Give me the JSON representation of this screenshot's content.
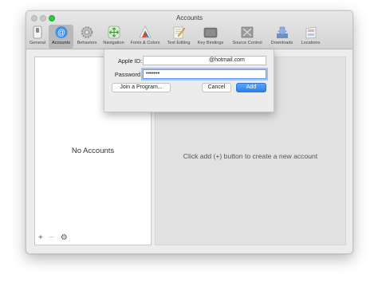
{
  "window": {
    "title": "Accounts",
    "accent": "#2a7ff0"
  },
  "toolbar": {
    "items": [
      {
        "label": "General",
        "icon": "switch-icon"
      },
      {
        "label": "Accounts",
        "icon": "at-sign-icon",
        "active": true
      },
      {
        "label": "Behaviors",
        "icon": "gear-icon"
      },
      {
        "label": "Navigation",
        "icon": "navigation-arrows-icon"
      },
      {
        "label": "Fonts & Colors",
        "icon": "color-palette-icon"
      },
      {
        "label": "Text Editing",
        "icon": "text-editing-icon"
      },
      {
        "label": "Key Bindings",
        "icon": "keyboard-icon"
      },
      {
        "label": "Source Control",
        "icon": "source-control-icon"
      },
      {
        "label": "Downloads",
        "icon": "downloads-icon"
      },
      {
        "label": "Locations",
        "icon": "locations-icon"
      }
    ]
  },
  "accounts_list": {
    "empty_text": "No Accounts",
    "add_symbol": "+",
    "remove_symbol": "−",
    "settings_symbol": "⚙"
  },
  "detail": {
    "hint": "Click add (+) button to create a new account"
  },
  "sheet": {
    "apple_id_label": "Apple ID:",
    "apple_id_value": "@hotmail.com",
    "password_label": "Password:",
    "password_value": "•••••••",
    "join_button": "Join a Program...",
    "cancel_button": "Cancel",
    "add_button": "Add"
  }
}
